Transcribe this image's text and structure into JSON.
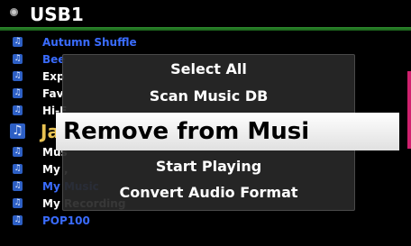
{
  "header": {
    "title": "USB1"
  },
  "list": {
    "items": [
      {
        "label": "Autumn Shuffle",
        "color": "blue"
      },
      {
        "label": "Bee",
        "color": "blue"
      },
      {
        "label": "Exp",
        "color": "white"
      },
      {
        "label": "Fav",
        "color": "white"
      },
      {
        "label": "Hi-F",
        "color": "white"
      },
      {
        "label": "Jaz",
        "color": "gold"
      },
      {
        "label": "Mus",
        "color": "white"
      },
      {
        "label": "My ,",
        "color": "white"
      },
      {
        "label": "My Music",
        "color": "blue"
      },
      {
        "label": "My Recording",
        "color": "white"
      },
      {
        "label": "POP100",
        "color": "blue"
      }
    ]
  },
  "popup": {
    "items": [
      {
        "label": "Select All"
      },
      {
        "label": "Scan Music DB"
      },
      {
        "label": "Remove from Musi"
      },
      {
        "label": "Start Playing"
      },
      {
        "label": "Convert Audio Format"
      }
    ],
    "selected_index": 2
  },
  "colors": {
    "header_rule": "#2e8a2e",
    "folder_icon": "#2d5fc4",
    "accent_right": "#d0206e",
    "text_blue": "#3a6cff",
    "text_gold": "#e8c252"
  },
  "icons": {
    "header": "disk-icon",
    "list_item": "music-folder-icon"
  }
}
